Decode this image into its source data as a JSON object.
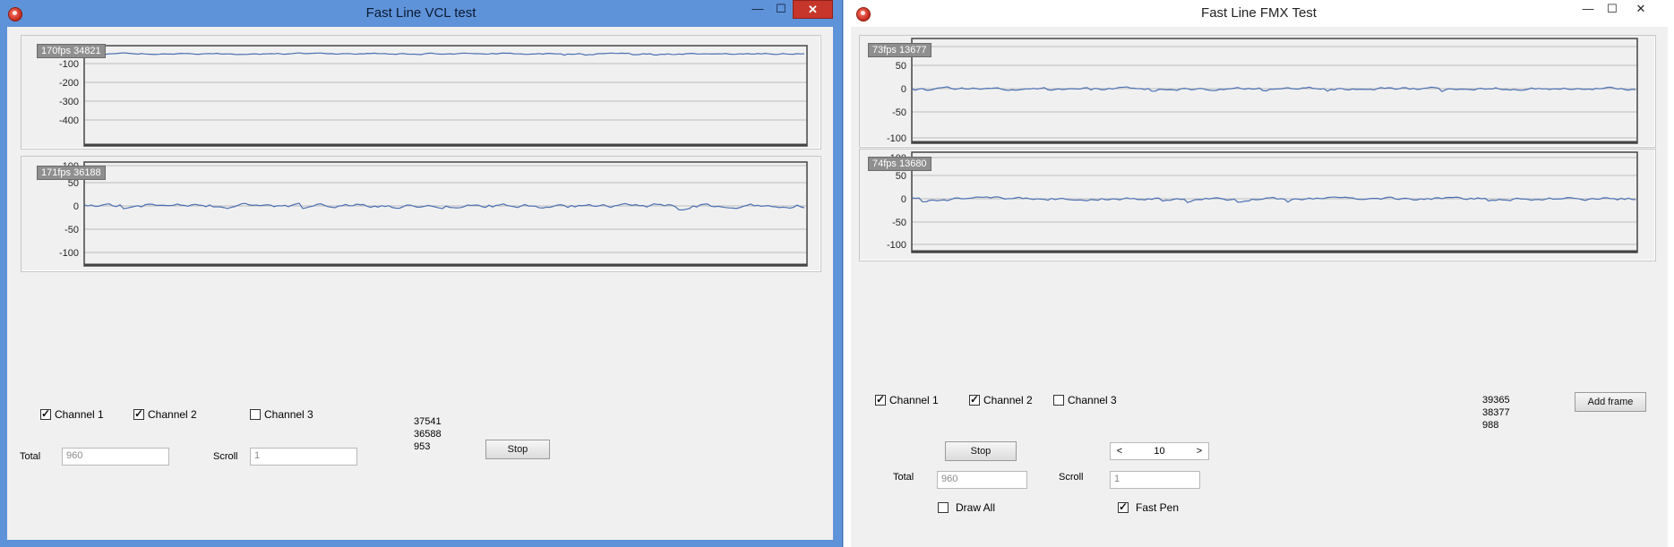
{
  "vcl": {
    "title": "Fast Line VCL test",
    "buttons": {
      "minimize": "—",
      "maximize": "☐",
      "close": "✕"
    },
    "charts": [
      {
        "fps": "170fps 34821",
        "yticks": [
          "-100",
          "-200",
          "-300",
          "-400"
        ]
      },
      {
        "fps": "171fps 36188",
        "yticks": [
          "100",
          "50",
          "0",
          "-50",
          "-100"
        ]
      }
    ],
    "channels": [
      {
        "label": "Channel 1",
        "checked": true
      },
      {
        "label": "Channel 2",
        "checked": true
      },
      {
        "label": "Channel 3",
        "checked": false
      }
    ],
    "stats": [
      "37541",
      "36588",
      "953"
    ],
    "stop_label": "Stop",
    "total_label": "Total",
    "total_value": "960",
    "scroll_label": "Scroll",
    "scroll_value": "1"
  },
  "fmx": {
    "title": "Fast Line FMX Test",
    "buttons": {
      "minimize": "—",
      "maximize": "☐",
      "close": "✕"
    },
    "charts": [
      {
        "fps": "73fps 13677",
        "yticks": [
          "100",
          "50",
          "0",
          "-50",
          "-100"
        ]
      },
      {
        "fps": "74fps 13680",
        "yticks": [
          "100",
          "50",
          "0",
          "-50",
          "-100"
        ]
      }
    ],
    "channels": [
      {
        "label": "Channel 1",
        "checked": true
      },
      {
        "label": "Channel 2",
        "checked": true
      },
      {
        "label": "Channel 3",
        "checked": false
      }
    ],
    "stats": [
      "39365",
      "38377",
      "988"
    ],
    "add_frame_label": "Add frame",
    "stop_label": "Stop",
    "spin_value": "10",
    "total_label": "Total",
    "total_value": "960",
    "scroll_label": "Scroll",
    "scroll_value": "1",
    "draw_all_label": "Draw All",
    "draw_all_checked": false,
    "fast_pen_label": "Fast Pen",
    "fast_pen_checked": true
  },
  "colors": {
    "series": "#4a6fb3",
    "grid": "#bdbdbd",
    "frame": "#444444",
    "vcl_title_bg": "#5f93d9",
    "close_red": "#c7362b"
  }
}
